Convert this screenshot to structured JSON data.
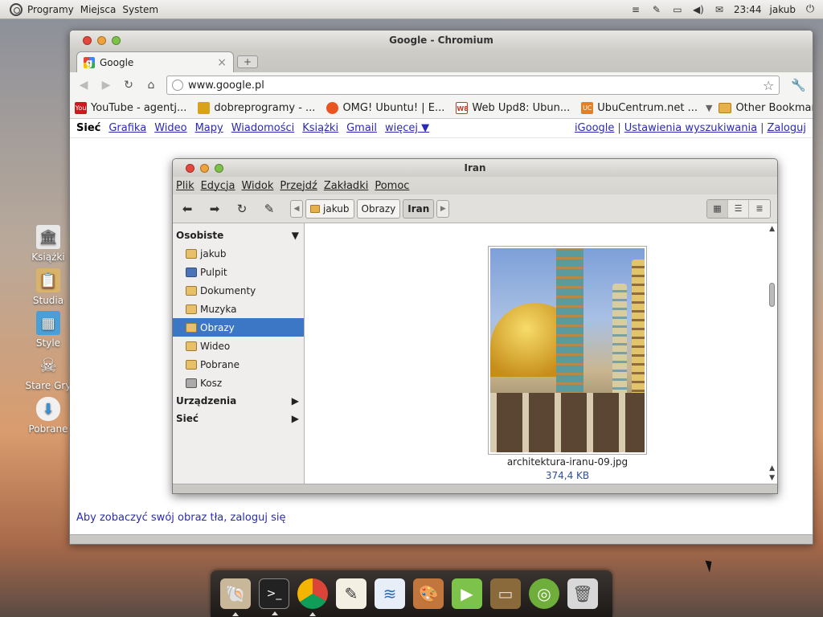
{
  "top_panel": {
    "menus": [
      "Programy",
      "Miejsca",
      "System"
    ],
    "clock": "23:44",
    "user": "jakub",
    "tray_icons": [
      "menu-lines-icon",
      "network-icon",
      "battery-icon",
      "volume-icon",
      "mail-icon"
    ]
  },
  "desktop_icons": [
    {
      "label": "Książki",
      "icon": "library-icon"
    },
    {
      "label": "Studia",
      "icon": "clipboard-icon"
    },
    {
      "label": "Style",
      "icon": "document-icon"
    },
    {
      "label": "Stare Gry",
      "icon": "skull-icon"
    },
    {
      "label": "Pobrane",
      "icon": "download-cloud-icon"
    }
  ],
  "chromium": {
    "window_title": "Google - Chromium",
    "tab_title": "Google",
    "url": "www.google.pl",
    "bookmarks": [
      {
        "label": "YouTube - agentj...",
        "color": "#cc181e"
      },
      {
        "label": "dobreprogramy - ...",
        "color": "#d9a21b"
      },
      {
        "label": "OMG! Ubuntu! | E...",
        "color": "#e95420"
      },
      {
        "label": "Web Upd8: Ubun...",
        "color": "#c0392b"
      },
      {
        "label": "UbuCentrum.net ...",
        "color": "#e67e22"
      }
    ],
    "other_bookmarks": "Other Bookmarks",
    "google_bar": {
      "active": "Sieć",
      "links": [
        "Grafika",
        "Wideo",
        "Mapy",
        "Wiadomości",
        "Książki",
        "Gmail",
        "więcej ▼"
      ],
      "right_links": [
        "iGoogle",
        "Ustawienia wyszukiwania",
        "Zaloguj"
      ],
      "separator": "|"
    },
    "signin_text": "Aby zobaczyć swój obraz tła, zaloguj się"
  },
  "files": {
    "window_title": "Iran",
    "menus": [
      "Plik",
      "Edycja",
      "Widok",
      "Przejdź",
      "Zakładki",
      "Pomoc"
    ],
    "breadcrumbs": [
      "jakub",
      "Obrazy",
      "Iran"
    ],
    "sidebar": {
      "personal_header": "Osobiste",
      "items": [
        "jakub",
        "Pulpit",
        "Dokumenty",
        "Muzyka",
        "Obrazy",
        "Wideo",
        "Pobrane",
        "Kosz"
      ],
      "selected": "Obrazy",
      "devices_header": "Urządzenia",
      "network_header": "Sieć"
    },
    "file": {
      "name": "architektura-iranu-09.jpg",
      "size": "374,4 KB"
    }
  },
  "dock": [
    "shell-icon",
    "terminal-icon",
    "chromium-icon",
    "text-editor-icon",
    "writer-icon",
    "paint-icon",
    "media-player-icon",
    "tv-icon",
    "ubuntu-software-icon",
    "trash-icon"
  ]
}
